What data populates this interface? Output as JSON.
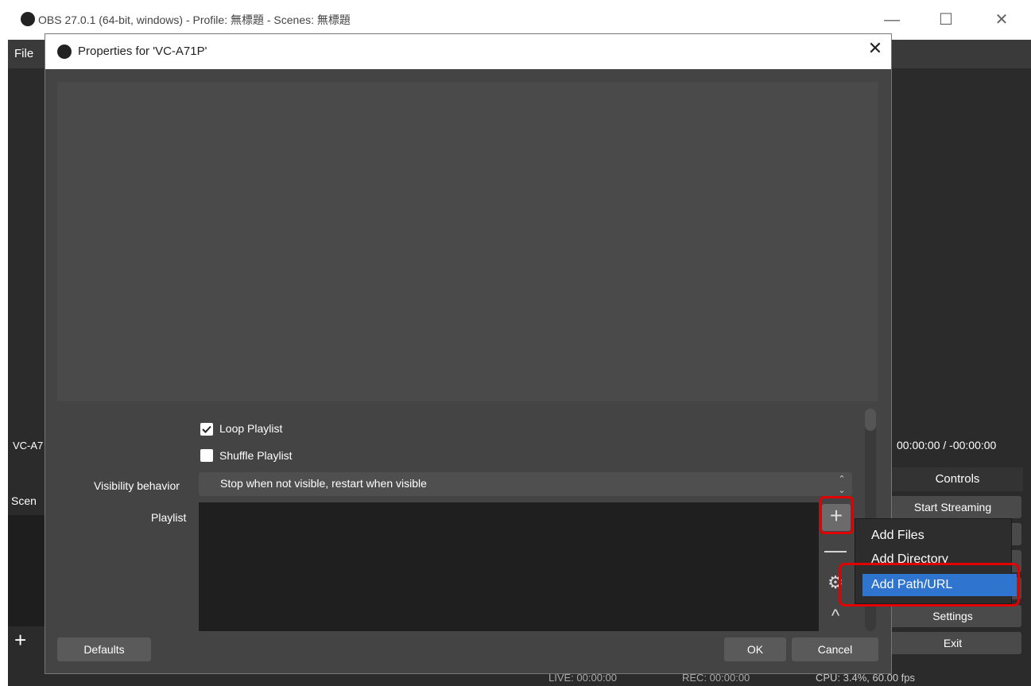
{
  "main_window": {
    "title": "OBS 27.0.1 (64-bit, windows) - Profile: 無標題 - Scenes: 無標題",
    "minimize": "—",
    "maximize": "☐",
    "close": "✕",
    "menu_file": "File",
    "source_name": "VC-A7",
    "scenes_header": "Scen",
    "scenes_add": "+",
    "time_readout": "00:00:00 / -00:00:00",
    "controls_header": "Controls",
    "controls": {
      "start_streaming": "Start Streaming",
      "settings": "Settings",
      "exit": "Exit"
    },
    "status": {
      "live": "LIVE: 00:00:00",
      "rec": "REC: 00:00:00",
      "cpu": "CPU: 3.4%, 60.00 fps"
    }
  },
  "dialog": {
    "title": "Properties for 'VC-A71P'",
    "close": "✕",
    "loop_playlist": {
      "label": "Loop Playlist",
      "checked": true
    },
    "shuffle_playlist": {
      "label": "Shuffle Playlist",
      "checked": false
    },
    "visibility": {
      "label": "Visibility behavior",
      "value": "Stop when not visible, restart when visible"
    },
    "playlist_label": "Playlist",
    "playlist_buttons": {
      "add": "+",
      "remove": "—",
      "config": "⚙",
      "move_up": "^"
    },
    "defaults": "Defaults",
    "ok": "OK",
    "cancel": "Cancel"
  },
  "context_menu": {
    "items": [
      "Add Files",
      "Add Directory",
      "Add Path/URL"
    ],
    "highlighted": "Add Path/URL"
  },
  "colors": {
    "highlight_red": "#e20000",
    "menu_selected": "#2f74cf"
  }
}
